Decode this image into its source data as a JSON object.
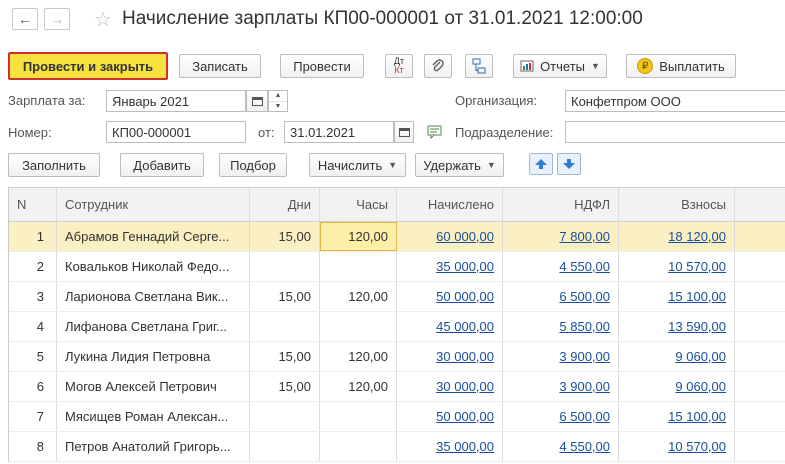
{
  "window": {
    "title": "Начисление зарплаты КП00-000001 от 31.01.2021 12:00:00",
    "back_glyph": "←",
    "forward_glyph": "→",
    "star_glyph": "☆"
  },
  "toolbar": {
    "post_close": "Провести и закрыть",
    "save": "Записать",
    "post": "Провести",
    "dtkt_top": "Дт",
    "dtkt_bottom": "Кт",
    "reports": "Отчеты",
    "pay": "Выплатить",
    "pay_icon_glyph": "₽"
  },
  "form": {
    "salary_for_label": "Зарплата за:",
    "salary_for_value": "Январь 2021",
    "number_label": "Номер:",
    "number_value": "КП00-000001",
    "from_label": "от:",
    "from_value": "31.01.2021",
    "org_label": "Организация:",
    "org_value": "Конфетпром ООО",
    "dept_label": "Подразделение:",
    "dept_value": ""
  },
  "table_toolbar": {
    "fill": "Заполнить",
    "add": "Добавить",
    "pick": "Подбор",
    "accrue": "Начислить",
    "withhold": "Удержать"
  },
  "table": {
    "columns": [
      "N",
      "Сотрудник",
      "Дни",
      "Часы",
      "Начислено",
      "НДФЛ",
      "Взносы"
    ],
    "rows": [
      {
        "n": "1",
        "employee": "Абрамов Геннадий Серге...",
        "days": "15,00",
        "hours": "120,00",
        "accrued": "60 000,00",
        "ndfl": "7 800,00",
        "contrib": "18 120,00"
      },
      {
        "n": "2",
        "employee": "Ковальков Николай Федо...",
        "days": "",
        "hours": "",
        "accrued": "35 000,00",
        "ndfl": "4 550,00",
        "contrib": "10 570,00"
      },
      {
        "n": "3",
        "employee": "Ларионова Светлана Вик...",
        "days": "15,00",
        "hours": "120,00",
        "accrued": "50 000,00",
        "ndfl": "6 500,00",
        "contrib": "15 100,00"
      },
      {
        "n": "4",
        "employee": "Лифанова Светлана Григ...",
        "days": "",
        "hours": "",
        "accrued": "45 000,00",
        "ndfl": "5 850,00",
        "contrib": "13 590,00"
      },
      {
        "n": "5",
        "employee": "Лукина Лидия Петровна",
        "days": "15,00",
        "hours": "120,00",
        "accrued": "30 000,00",
        "ndfl": "3 900,00",
        "contrib": "9 060,00"
      },
      {
        "n": "6",
        "employee": "Могов Алексей Петрович",
        "days": "15,00",
        "hours": "120,00",
        "accrued": "30 000,00",
        "ndfl": "3 900,00",
        "contrib": "9 060,00"
      },
      {
        "n": "7",
        "employee": "Мясищев Роман Алексан...",
        "days": "",
        "hours": "",
        "accrued": "50 000,00",
        "ndfl": "6 500,00",
        "contrib": "15 100,00"
      },
      {
        "n": "8",
        "employee": "Петров Анатолий Григорь...",
        "days": "",
        "hours": "",
        "accrued": "35 000,00",
        "ndfl": "4 550,00",
        "contrib": "10 570,00"
      }
    ]
  },
  "colors": {
    "primary_button": "#f5e23f",
    "primary_border": "#d32f2f",
    "selected_row": "#fbf0c4",
    "link": "#1a4f9c"
  }
}
